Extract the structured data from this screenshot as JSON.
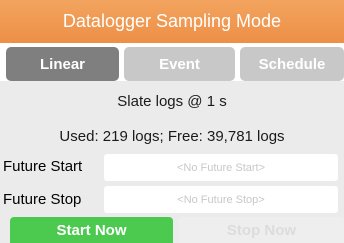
{
  "header": {
    "title": "Datalogger Sampling Mode"
  },
  "tabs": [
    {
      "label": "Linear",
      "state": "selected"
    },
    {
      "label": "Event",
      "state": "unselected"
    },
    {
      "label": "Schedule",
      "state": "unselected"
    }
  ],
  "status": {
    "line1": "Slate logs @ 1 s",
    "line2": "Used: 219 logs; Free: 39,781 logs"
  },
  "future_start": {
    "label": "Future Start",
    "placeholder": "<No Future Start>"
  },
  "future_stop": {
    "label": "Future Stop",
    "placeholder": "<No Future Stop>"
  },
  "buttons": {
    "start_now": "Start Now",
    "stop_now": "Stop Now",
    "stop_now_state": "disabled"
  },
  "colors": {
    "header": "#ee9246",
    "tab_selected": "#7f7f7f",
    "tab_unselected": "#c8c8c8",
    "start_button": "#4cc94f",
    "stop_button_disabled": "#eeeeee"
  }
}
